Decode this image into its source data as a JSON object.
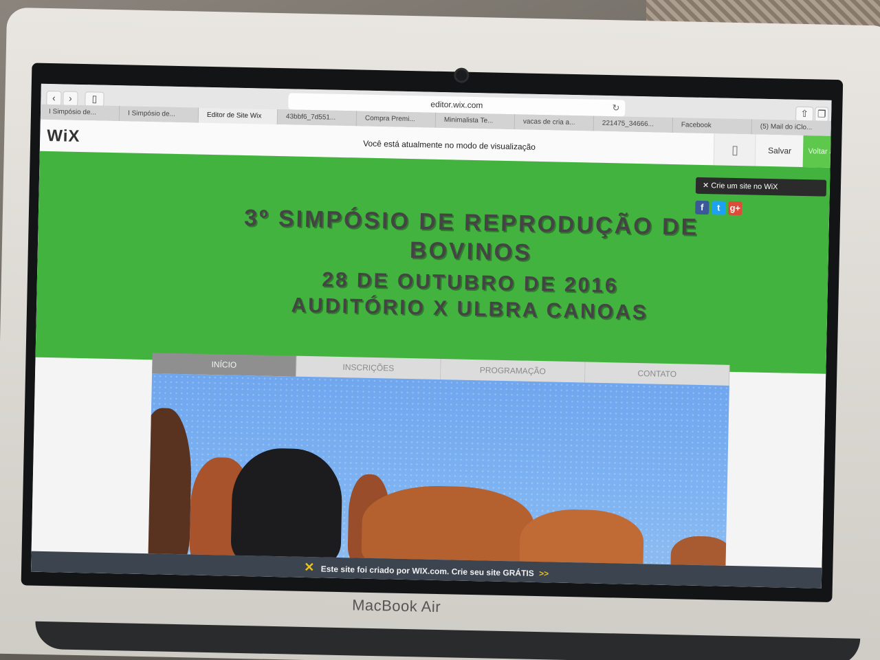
{
  "browser": {
    "url": "editor.wix.com",
    "tabs": [
      {
        "label": "I Simpósio de...",
        "active": false
      },
      {
        "label": "I Simpósio de...",
        "active": false
      },
      {
        "label": "Editor de Site Wix",
        "active": true
      },
      {
        "label": "43bbf6_7d551...",
        "active": false
      },
      {
        "label": "Compra Premi...",
        "active": false
      },
      {
        "label": "Minimalista Te...",
        "active": false
      },
      {
        "label": "vacas de cria a...",
        "active": false
      },
      {
        "label": "221475_34666...",
        "active": false
      },
      {
        "label": "Facebook",
        "active": false
      },
      {
        "label": "(5) Mail do iClo...",
        "active": false
      }
    ]
  },
  "wix_bar": {
    "logo": "WiX",
    "preview_message": "Você está atualmente no modo de visualização",
    "save_label": "Salvar",
    "back_label": "Voltar ao Editor"
  },
  "site": {
    "crie_label": "Crie um site no WiX",
    "title_line1": "3º Simpósio de Reprodução de",
    "title_line2": "Bovinos",
    "date_line": "28 de Outubro de 2016",
    "place_line": "Auditório X Ulbra Canoas",
    "menu": [
      {
        "label": "Início",
        "active": true
      },
      {
        "label": "Inscrições",
        "active": false
      },
      {
        "label": "Programação",
        "active": false
      },
      {
        "label": "Contato",
        "active": false
      }
    ],
    "footer": {
      "text": "Este site foi criado por WIX.com. Crie seu site GRÁTIS",
      "arrow": ">>"
    }
  },
  "device": {
    "model": "MacBook Air"
  },
  "colors": {
    "hero_green": "#43b33f",
    "editor_green": "#5ec84c",
    "footer_bg": "#3c4450"
  }
}
